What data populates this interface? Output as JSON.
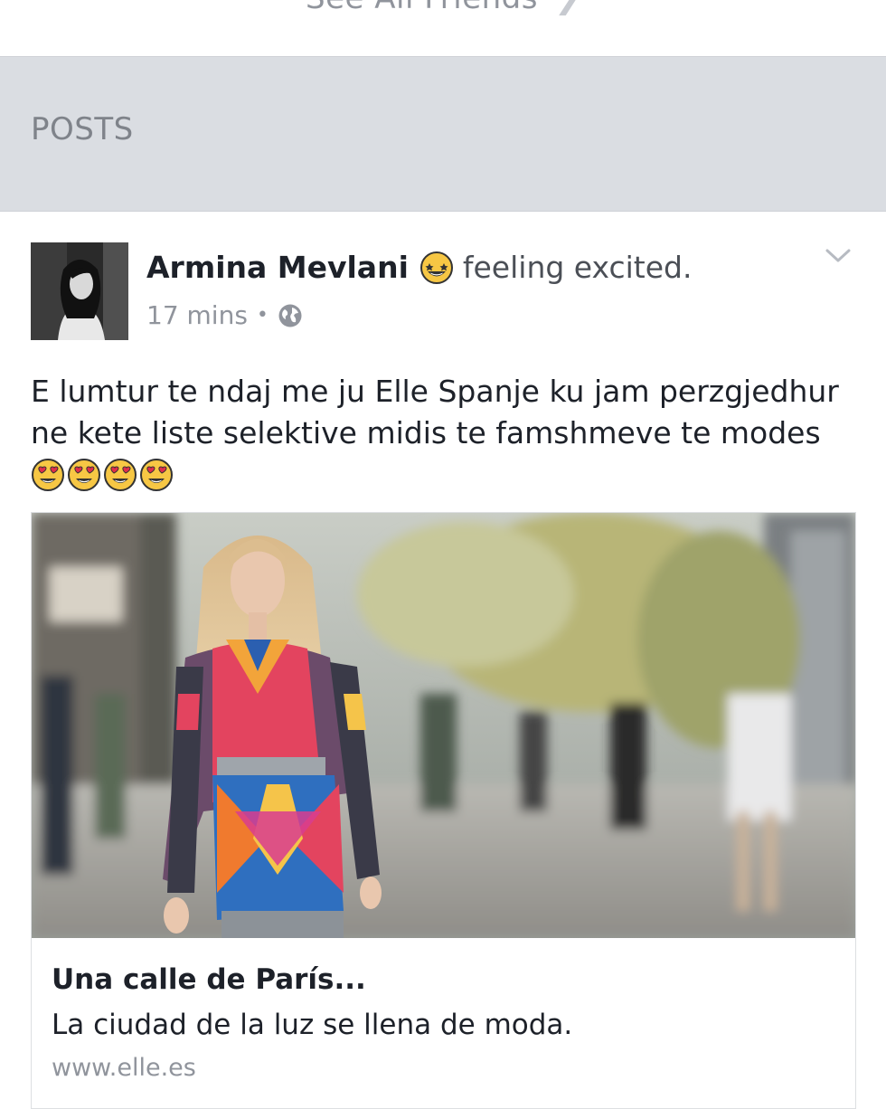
{
  "header": {
    "see_all_friends": "See All Friends"
  },
  "section": {
    "posts_label": "POSTS"
  },
  "post": {
    "author": "Armina Mevlani",
    "feeling_icon": "grinning-star-eyes-emoji",
    "feeling": "feeling excited.",
    "time": "17 mins",
    "separator": "•",
    "privacy_icon": "globe-icon",
    "text": "E lumtur te ndaj me ju Elle Spanje ku jam perzgjedhur ne kete liste selektive midis te famshmeve te modes",
    "emojis": [
      "heart-eyes-emoji",
      "heart-eyes-emoji",
      "heart-eyes-emoji",
      "heart-eyes-emoji"
    ],
    "link": {
      "title": "Una calle de París...",
      "description": "La ciudad de la luz se llena de moda.",
      "domain": "www.elle.es"
    }
  },
  "colors": {
    "section_bg": "#dadde2",
    "meta_gray": "#90949c",
    "text_dark": "#1d2129",
    "emoji_yellow": "#f7c744"
  }
}
